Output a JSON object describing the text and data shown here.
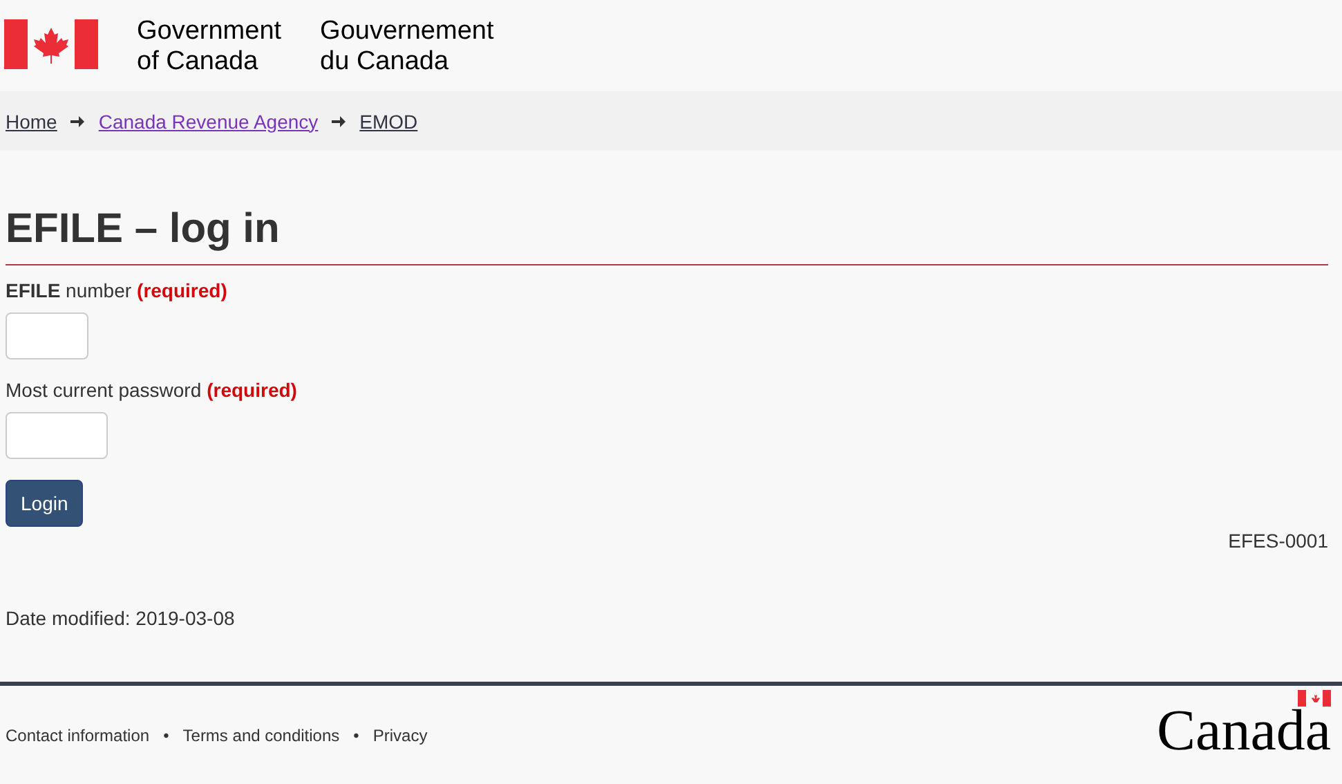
{
  "header": {
    "signature_en": [
      "Government",
      "of Canada"
    ],
    "signature_fr": [
      "Gouvernement",
      "du Canada"
    ]
  },
  "breadcrumb": [
    {
      "label": "Home",
      "visited": false
    },
    {
      "label": "Canada Revenue Agency",
      "visited": true
    },
    {
      "label": "EMOD",
      "visited": false
    }
  ],
  "title": "EFILE – log in",
  "fields": [
    {
      "label": "**EFILE** number",
      "required": "(required)"
    },
    {
      "label": "Most current password",
      "required": "(required)"
    }
  ],
  "button": "Login",
  "page_id": "EFES-0001",
  "date_modified": "Date modified: 2019-03-08",
  "footer": {
    "links": [
      "Contact information",
      "Terms and conditions",
      "Privacy"
    ],
    "separator": "•",
    "wordmark": "Canada"
  }
}
